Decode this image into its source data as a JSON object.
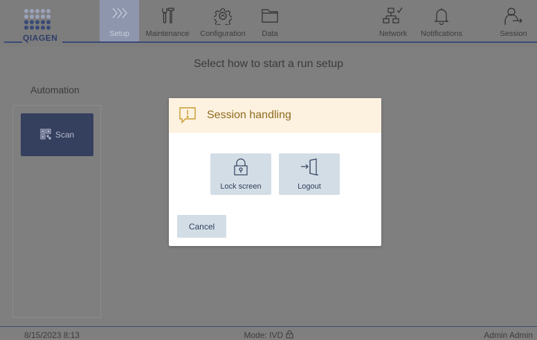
{
  "brand": {
    "logo_text": "QIAGEN"
  },
  "nav": {
    "items": [
      {
        "label": "Setup",
        "icon": "setup-chevrons-icon",
        "active": true
      },
      {
        "label": "Maintenance",
        "icon": "tools-icon",
        "active": false
      },
      {
        "label": "Configuration",
        "icon": "gear-icon",
        "active": false
      },
      {
        "label": "Data",
        "icon": "folder-icon",
        "active": false
      },
      {
        "label": "Network",
        "icon": "network-icon",
        "active": false
      },
      {
        "label": "Notifications",
        "icon": "bell-icon",
        "active": false
      },
      {
        "label": "Session",
        "icon": "session-user-icon",
        "active": false
      }
    ]
  },
  "main": {
    "heading": "Select how to start a run setup",
    "automation_label": "Automation",
    "scan_label": "Scan"
  },
  "dialog": {
    "title": "Session handling",
    "warning_icon": "warning-bubble-icon",
    "lock_label": "Lock screen",
    "logout_label": "Logout",
    "cancel_label": "Cancel"
  },
  "status": {
    "datetime": "8/15/2023 8:13",
    "mode": "Mode: IVD",
    "user": "Admin Admin"
  },
  "colors": {
    "brand_navy": "#3a4a77",
    "dialog_header": "#fdf1df",
    "dialog_title": "#8d6a1e",
    "action_button": "#d3dde6",
    "scan_button": "#353f5e"
  }
}
